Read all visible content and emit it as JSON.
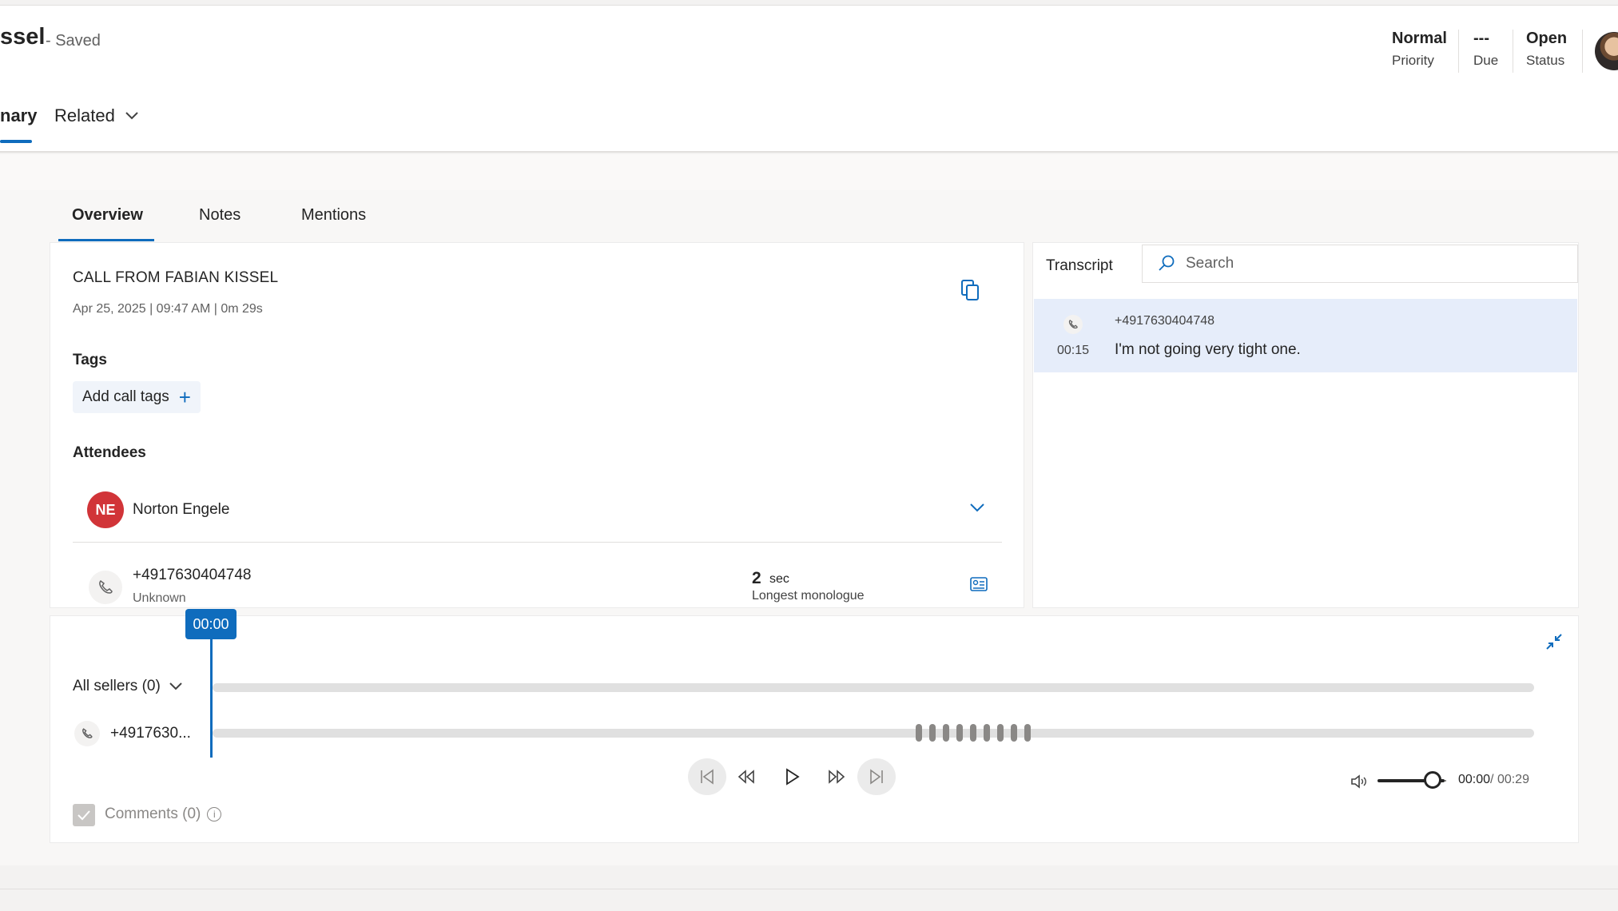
{
  "header": {
    "title": "ssel",
    "saved": "- Saved",
    "fields": [
      {
        "value": "Normal",
        "label": "Priority"
      },
      {
        "value": "---",
        "label": "Due"
      },
      {
        "value": "Open",
        "label": "Status"
      }
    ],
    "tabs": {
      "summary": "nary",
      "related": "Related"
    }
  },
  "inner_tabs": [
    "Overview",
    "Notes",
    "Mentions"
  ],
  "overview": {
    "call_title": "CALL FROM FABIAN KISSEL",
    "call_meta": "Apr 25, 2025 | 09:47 AM | 0m 29s",
    "tags_heading": "Tags",
    "add_tags": "Add call tags",
    "attendees_heading": "Attendees",
    "attendee": {
      "initials": "NE",
      "name": "Norton Engele",
      "color": "#d13438"
    },
    "phone": {
      "number": "+4917630404748",
      "status": "Unknown"
    },
    "monologue": {
      "value": "2",
      "unit": "sec",
      "label": "Longest monologue"
    }
  },
  "transcript": {
    "label": "Transcript",
    "search_placeholder": "Search",
    "entries": [
      {
        "time": "00:15",
        "speaker": "+4917630404748",
        "text": "I'm not going very tight one."
      }
    ]
  },
  "player": {
    "cursor_time": "00:00",
    "sellers": "All sellers (0)",
    "speaker": "+4917630...",
    "current": "00:00",
    "total": "/ 00:29",
    "volume": 0.75,
    "comments": "Comments (0)"
  },
  "colors": {
    "accent": "#0f6cbd",
    "avatar": "#d13438",
    "transcript_highlight": "#e6edfa"
  }
}
